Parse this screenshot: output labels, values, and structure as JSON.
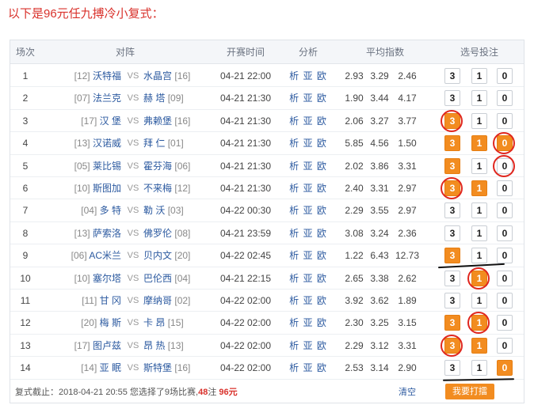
{
  "headline": "以下是96元任九搏冷小复式：",
  "headers": {
    "round": "场次",
    "match": "对阵",
    "time": "开赛时间",
    "analysis": "分析",
    "odds": "平均指数",
    "bet": "选号投注"
  },
  "vs": "VS",
  "analysis_label": "析 亚 欧",
  "rows": [
    {
      "no": "1",
      "home_rank": "[12]",
      "home": "沃特福",
      "away": "水晶宫",
      "away_rank": "[16]",
      "time": "04-21 22:00",
      "o1": "2.93",
      "o2": "3.29",
      "o3": "2.46",
      "opt3": "3",
      "opt1": "1",
      "opt0": "0",
      "sel": [
        false,
        false,
        false
      ],
      "ring": [
        false,
        false,
        false
      ]
    },
    {
      "no": "2",
      "home_rank": "[07]",
      "home": "法兰克",
      "away": "赫 塔",
      "away_rank": "[09]",
      "time": "04-21 21:30",
      "o1": "1.90",
      "o2": "3.44",
      "o3": "4.17",
      "opt3": "3",
      "opt1": "1",
      "opt0": "0",
      "sel": [
        false,
        false,
        false
      ],
      "ring": [
        false,
        false,
        false
      ]
    },
    {
      "no": "3",
      "home_rank": "[17]",
      "home": "汉 堡",
      "away": "弗赖堡",
      "away_rank": "[16]",
      "time": "04-21 21:30",
      "o1": "2.06",
      "o2": "3.27",
      "o3": "3.77",
      "opt3": "3",
      "opt1": "1",
      "opt0": "0",
      "sel": [
        true,
        false,
        false
      ],
      "ring": [
        true,
        false,
        false
      ]
    },
    {
      "no": "4",
      "home_rank": "[13]",
      "home": "汉诺威",
      "away": "拜 仁",
      "away_rank": "[01]",
      "time": "04-21 21:30",
      "o1": "5.85",
      "o2": "4.56",
      "o3": "1.50",
      "opt3": "3",
      "opt1": "1",
      "opt0": "0",
      "sel": [
        true,
        true,
        true
      ],
      "ring": [
        false,
        false,
        true
      ]
    },
    {
      "no": "5",
      "home_rank": "[05]",
      "home": "莱比锡",
      "away": "霍芬海",
      "away_rank": "[06]",
      "time": "04-21 21:30",
      "o1": "2.02",
      "o2": "3.86",
      "o3": "3.31",
      "opt3": "3",
      "opt1": "1",
      "opt0": "0",
      "sel": [
        true,
        false,
        false
      ],
      "ring": [
        false,
        false,
        true
      ]
    },
    {
      "no": "6",
      "home_rank": "[10]",
      "home": "斯图加",
      "away": "不来梅",
      "away_rank": "[12]",
      "time": "04-21 21:30",
      "o1": "2.40",
      "o2": "3.31",
      "o3": "2.97",
      "opt3": "3",
      "opt1": "1",
      "opt0": "0",
      "sel": [
        true,
        true,
        false
      ],
      "ring": [
        true,
        false,
        false
      ]
    },
    {
      "no": "7",
      "home_rank": "[04]",
      "home": "多 特",
      "away": "勒 沃",
      "away_rank": "[03]",
      "time": "04-22 00:30",
      "o1": "2.29",
      "o2": "3.55",
      "o3": "2.97",
      "opt3": "3",
      "opt1": "1",
      "opt0": "0",
      "sel": [
        false,
        false,
        false
      ],
      "ring": [
        false,
        false,
        false
      ]
    },
    {
      "no": "8",
      "home_rank": "[13]",
      "home": "萨索洛",
      "away": "佛罗伦",
      "away_rank": "[08]",
      "time": "04-21 23:59",
      "o1": "3.08",
      "o2": "3.24",
      "o3": "2.36",
      "opt3": "3",
      "opt1": "1",
      "opt0": "0",
      "sel": [
        false,
        false,
        false
      ],
      "ring": [
        false,
        false,
        false
      ]
    },
    {
      "no": "9",
      "home_rank": "[06]",
      "home": "AC米兰",
      "away": "贝内文",
      "away_rank": "[20]",
      "time": "04-22 02:45",
      "o1": "1.22",
      "o2": "6.43",
      "o3": "12.73",
      "opt3": "3",
      "opt1": "1",
      "opt0": "0",
      "sel": [
        true,
        false,
        false
      ],
      "ring": [
        false,
        false,
        false
      ]
    },
    {
      "no": "10",
      "home_rank": "[10]",
      "home": "塞尔塔",
      "away": "巴伦西",
      "away_rank": "[04]",
      "time": "04-21 22:15",
      "o1": "2.65",
      "o2": "3.38",
      "o3": "2.62",
      "opt3": "3",
      "opt1": "1",
      "opt0": "0",
      "sel": [
        false,
        true,
        false
      ],
      "ring": [
        false,
        true,
        false
      ]
    },
    {
      "no": "11",
      "home_rank": "[11]",
      "home": "甘 冈",
      "away": "摩纳哥",
      "away_rank": "[02]",
      "time": "04-22 02:00",
      "o1": "3.92",
      "o2": "3.62",
      "o3": "1.89",
      "opt3": "3",
      "opt1": "1",
      "opt0": "0",
      "sel": [
        false,
        false,
        false
      ],
      "ring": [
        false,
        false,
        false
      ]
    },
    {
      "no": "12",
      "home_rank": "[20]",
      "home": "梅 斯",
      "away": "卡 昂",
      "away_rank": "[15]",
      "time": "04-22 02:00",
      "o1": "2.30",
      "o2": "3.25",
      "o3": "3.15",
      "opt3": "3",
      "opt1": "1",
      "opt0": "0",
      "sel": [
        true,
        true,
        false
      ],
      "ring": [
        false,
        true,
        false
      ]
    },
    {
      "no": "13",
      "home_rank": "[17]",
      "home": "图卢兹",
      "away": "昂 热",
      "away_rank": "[13]",
      "time": "04-22 02:00",
      "o1": "2.29",
      "o2": "3.12",
      "o3": "3.31",
      "opt3": "3",
      "opt1": "1",
      "opt0": "0",
      "sel": [
        true,
        true,
        false
      ],
      "ring": [
        true,
        false,
        false
      ]
    },
    {
      "no": "14",
      "home_rank": "[14]",
      "home": "亚 眠",
      "away": "斯特堡",
      "away_rank": "[16]",
      "time": "04-22 02:00",
      "o1": "2.53",
      "o2": "3.14",
      "o3": "2.90",
      "opt3": "3",
      "opt1": "1",
      "opt0": "0",
      "sel": [
        false,
        false,
        true
      ],
      "ring": [
        false,
        false,
        false
      ]
    }
  ],
  "footer": {
    "prefix": "复式截止：2018-04-21 20:55 您选择了9场比赛,",
    "amount_count": "48",
    "mid": "注 ",
    "amount_money": "96元",
    "clear": "清空",
    "submit": "我要打擂"
  },
  "colors": {
    "headline": "#d9312b",
    "selected": "#f28c20",
    "ring": "#e0261e",
    "link": "#2c5aa0"
  }
}
